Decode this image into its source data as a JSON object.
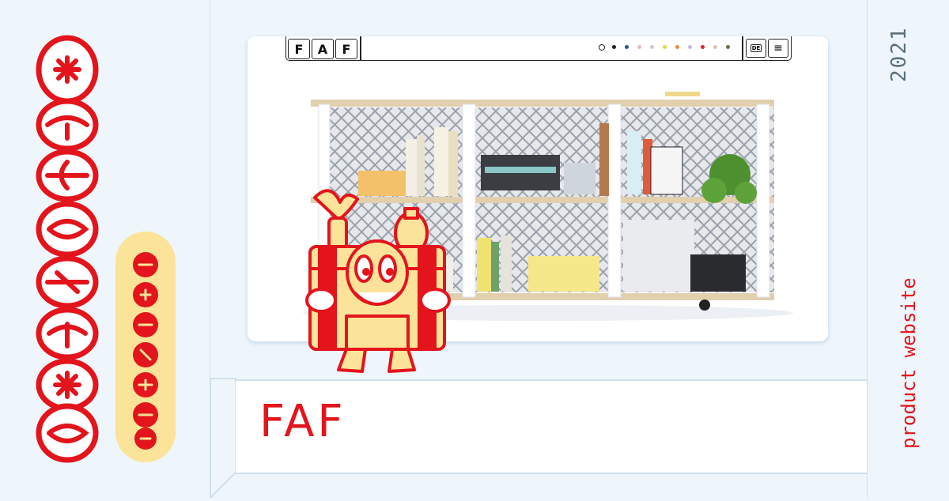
{
  "project": {
    "title": "FAF",
    "year": "2021",
    "category": "product website"
  },
  "sticker": {
    "wordmark": "MOGELINO",
    "badge": "PROJECT"
  },
  "site_nav": {
    "logo_letters": [
      "F",
      "A",
      "F"
    ],
    "language_label": "DE",
    "color_options": [
      "#ffffff",
      "#222222",
      "#2e4fa0",
      "#e8b9c9",
      "#c9c9d8",
      "#e8d64a",
      "#f08a3c",
      "#c9b8e0",
      "#e02a2a",
      "#d9c3b0",
      "#6d6f52"
    ]
  },
  "colors": {
    "accent": "#e3141b",
    "background": "#eef6fc",
    "frame": "#cfe0ec",
    "muted": "#5c6f7c",
    "badge_fill": "#fbe49a"
  },
  "icons": {
    "menu": "hamburger-icon",
    "language": "language-speech-icon"
  }
}
